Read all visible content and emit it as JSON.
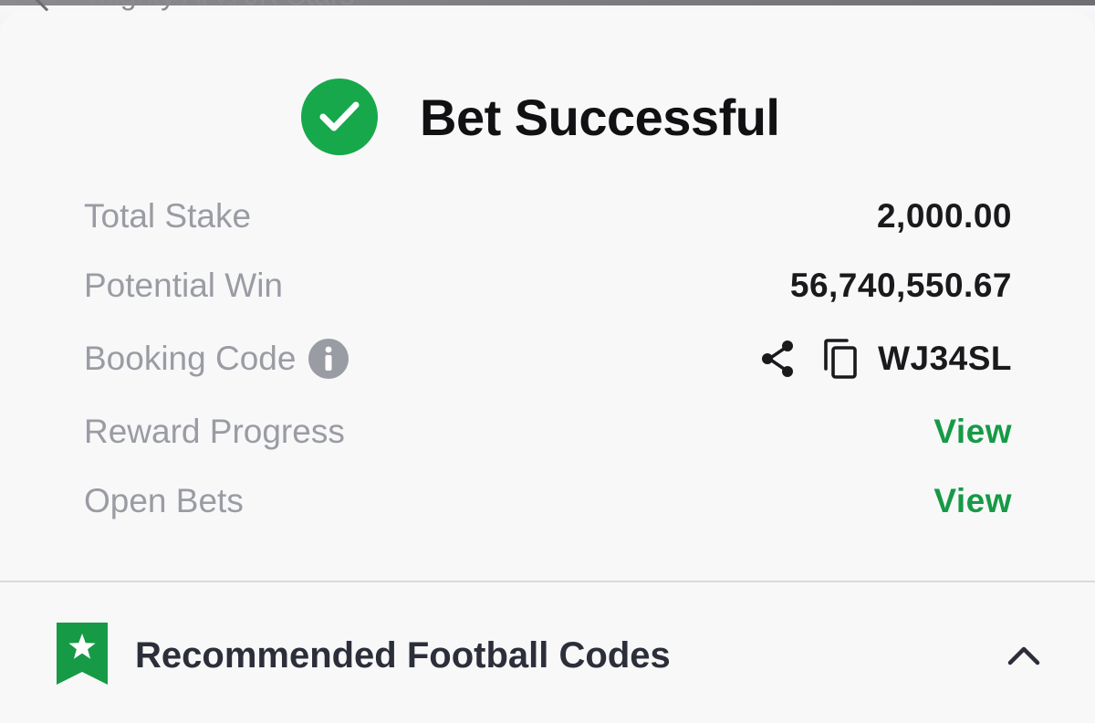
{
  "header": {
    "match_title_left": "Mighty Al",
    "match_title_vs": "vs",
    "match_title_right": "JK Stars"
  },
  "result": {
    "title": "Bet Successful",
    "status_color": "#17a84b"
  },
  "summary": {
    "total_stake_label": "Total Stake",
    "total_stake_value": "2,000.00",
    "potential_win_label": "Potential Win",
    "potential_win_value": "56,740,550.67",
    "booking_code_label": "Booking Code",
    "booking_code_value": "WJ34SL",
    "reward_progress_label": "Reward Progress",
    "reward_progress_link": "View",
    "open_bets_label": "Open Bets",
    "open_bets_link": "View",
    "link_color": "#169a45"
  },
  "recommended": {
    "title": "Recommended Football Codes",
    "icon": "bookmark-star-icon",
    "toggle_icon": "chevron-up-icon"
  }
}
